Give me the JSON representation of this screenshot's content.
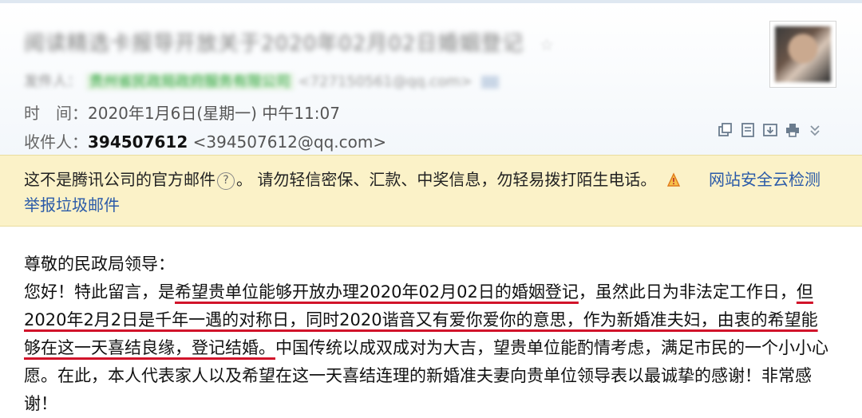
{
  "header": {
    "subject": "阅读精选卡报导开放关于2020年02月02日婚姻登记",
    "sender_label": "发件人：",
    "sender_name": "贵州省民政局政府服务有限公司",
    "sender_address": "<727150561@qq.com>",
    "time_label": "时　间：",
    "time_value": "2020年1月6日(星期一) 中午11:07",
    "to_label": "收件人：",
    "to_id": "394507612",
    "to_address": "<394507612@qq.com>"
  },
  "toolbar_icons": [
    "copy-icon",
    "note-icon",
    "download-icon",
    "print-icon",
    "expand-chevron-icon"
  ],
  "warning": {
    "text_part1": "这不是腾讯公司的官方邮件",
    "qmark": "?",
    "text_part2": "。 请勿轻信密保、汇款、中奖信息，勿轻易拨打陌生电话。",
    "report_label": "举报垃圾邮件",
    "security_link": "网站安全云检测"
  },
  "body": {
    "greeting": "尊敬的民政局领导：",
    "p_a": "您好！特此留言，是",
    "p_u1": "希望贵单位能够开放办理2020年02月02日的婚姻登记",
    "p_b": "，虽然此日为非法定工作日，",
    "p_u2": "但2020年2月2日是千年一遇的对称日，同时2020谐音又有爱你爱你的意思，作为新婚准夫妇，由衷的希望能够在这一天喜结良缘，登记结婚。",
    "p_c": "中国传统以成双成对为大吉，望贵单位能酌情考虑，满足市民的一个小小心愿。在此，本人代表家人以及希望在这一天喜结连理的新婚准夫妻向贵单位领导表以最诚挚的感谢！非常感谢！"
  },
  "colors": {
    "link": "#2a5aa8",
    "warning_bg": "#fbf2c8",
    "underline": "#d1132a"
  }
}
